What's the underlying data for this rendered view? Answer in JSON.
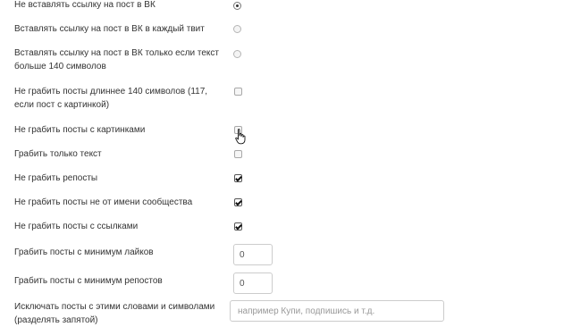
{
  "options": [
    {
      "label": "Не вставлять ссылку на пост в ВК",
      "checked": true
    },
    {
      "label": "Вставлять ссылку на пост в ВК в каждый твит",
      "checked": false
    },
    {
      "label": "Вставлять ссылку на пост в ВК только если текст больше 140 символов",
      "checked": false
    }
  ],
  "checkboxes": [
    {
      "label": "Не грабить посты длиннее 140 символов (117, если пост с картинкой)",
      "checked": false
    },
    {
      "label": "Не грабить посты с картинками",
      "checked": false
    },
    {
      "label": "Грабить только текст",
      "checked": false
    },
    {
      "label": "Не грабить репосты",
      "checked": true
    },
    {
      "label": "Не грабить посты не от имени сообщества",
      "checked": true
    },
    {
      "label": "Не грабить посты с ссылками",
      "checked": true
    }
  ],
  "min_likes": {
    "label": "Грабить посты с минимум лайков",
    "value": "0"
  },
  "min_reposts": {
    "label": "Грабить посты с минимум репостов",
    "value": "0"
  },
  "exclude_words": {
    "label": "Исключать посты с этими словами и символами (разделять запятой)",
    "value": "",
    "placeholder": "например Купи, подпишись и т.д."
  },
  "icons": {
    "cursor": "hand-pointer-icon"
  }
}
